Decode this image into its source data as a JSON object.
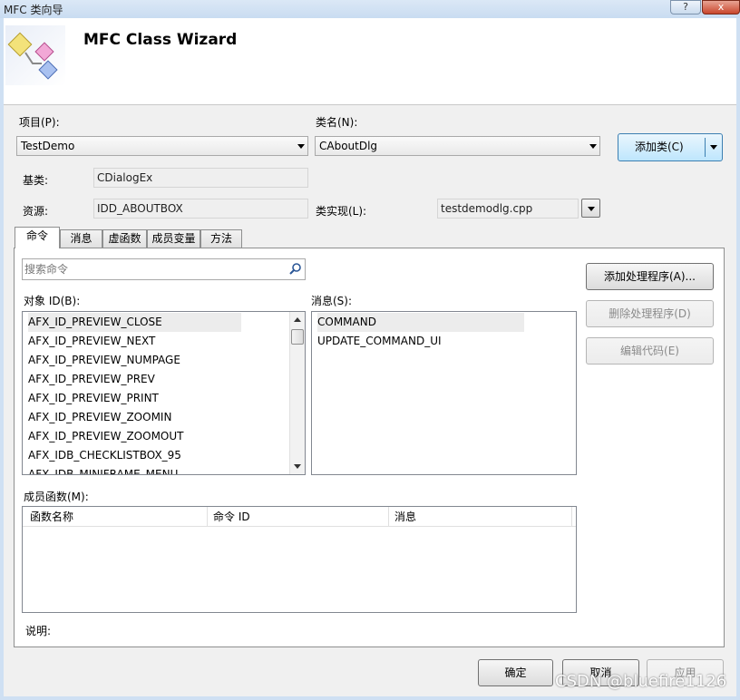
{
  "window": {
    "title": "MFC 类向导",
    "help_glyph": "?",
    "close_glyph": "x"
  },
  "header": {
    "title": "MFC Class Wizard",
    "logo": "wizard-logo-icon"
  },
  "project": {
    "label": "项目(P):",
    "value": "TestDemo"
  },
  "class_name": {
    "label": "类名(N):",
    "value": "CAboutDlg"
  },
  "add_class_button": "添加类(C)",
  "base_class": {
    "label": "基类:",
    "value": "CDialogEx"
  },
  "resource": {
    "label": "资源:",
    "value": "IDD_ABOUTBOX"
  },
  "class_impl": {
    "label": "类实现(L):",
    "value": "testdemodlg.cpp"
  },
  "tabs": [
    {
      "label": "命令",
      "active": true
    },
    {
      "label": "消息",
      "active": false
    },
    {
      "label": "虚函数",
      "active": false
    },
    {
      "label": "成员变量",
      "active": false
    },
    {
      "label": "方法",
      "active": false
    }
  ],
  "search": {
    "placeholder": "搜索命令"
  },
  "object_ids": {
    "label": "对象 ID(B):",
    "items": [
      "AFX_ID_PREVIEW_CLOSE",
      "AFX_ID_PREVIEW_NEXT",
      "AFX_ID_PREVIEW_NUMPAGE",
      "AFX_ID_PREVIEW_PREV",
      "AFX_ID_PREVIEW_PRINT",
      "AFX_ID_PREVIEW_ZOOMIN",
      "AFX_ID_PREVIEW_ZOOMOUT",
      "AFX_IDB_CHECKLISTBOX_95",
      "AFX_IDB_MINIFRAME_MENU"
    ],
    "selected_index": 0
  },
  "messages": {
    "label": "消息(S):",
    "items": [
      "COMMAND",
      "UPDATE_COMMAND_UI"
    ],
    "selected_index": 0
  },
  "handler_buttons": {
    "add": "添加处理程序(A)...",
    "delete": "删除处理程序(D)",
    "edit": "编辑代码(E)"
  },
  "member_functions": {
    "label": "成员函数(M):",
    "columns": [
      "函数名称",
      "命令 ID",
      "消息"
    ],
    "rows": []
  },
  "description": {
    "label": "说明:"
  },
  "footer": {
    "ok": "确定",
    "cancel": "取消",
    "apply": "应用"
  },
  "watermark": "CSDN @bluefire1126"
}
